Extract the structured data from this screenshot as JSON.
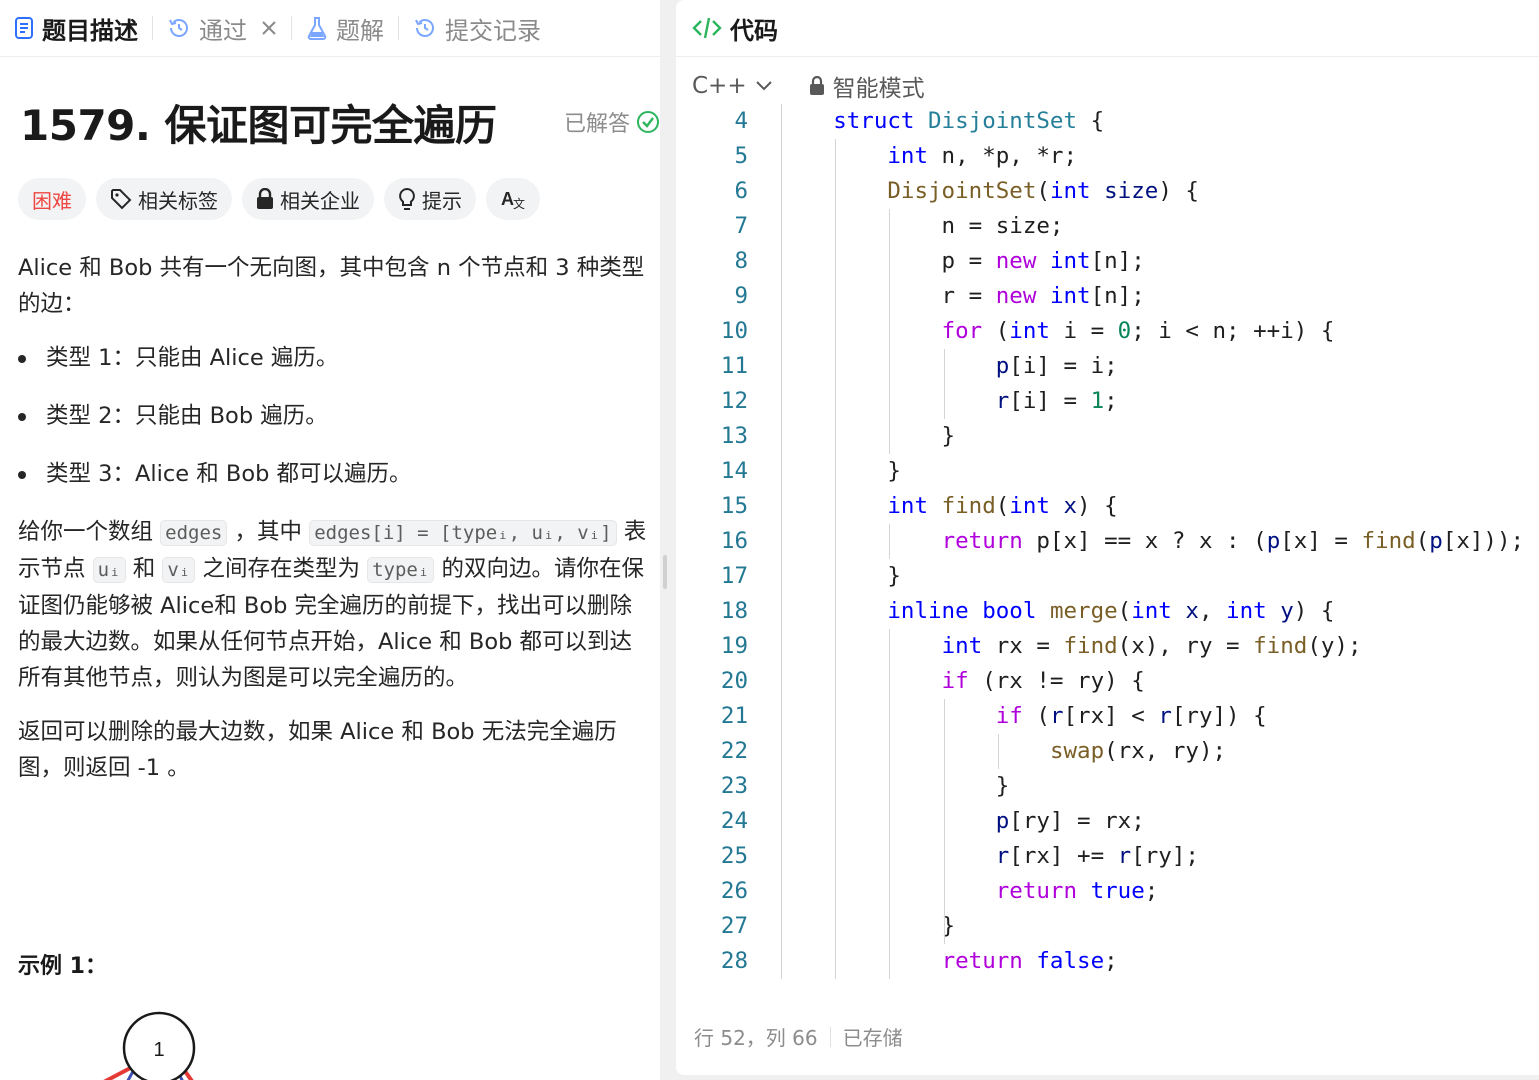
{
  "left_tabs": {
    "description": "题目描述",
    "passed": "通过",
    "solutions": "题解",
    "submissions": "提交记录"
  },
  "problem": {
    "title": "1579. 保证图可完全遍历",
    "status": "已解答",
    "chips": {
      "difficulty": "困难",
      "tags": "相关标签",
      "companies": "相关企业",
      "hint": "提示"
    },
    "intro": "Alice 和 Bob 共有一个无向图，其中包含 n 个节点和 3  种类型的边：",
    "types": [
      "类型 1：只能由 Alice 遍历。",
      "类型 2：只能由 Bob 遍历。",
      "类型 3：Alice 和 Bob 都可以遍历。"
    ],
    "para2": {
      "t1": "给你一个数组",
      "c1": "edges",
      "t2": "，其中",
      "c2": "edges[i] = [typeᵢ, uᵢ, vᵢ]",
      "t3": "表示节点",
      "c3": "uᵢ",
      "t4": "和",
      "c4": "vᵢ",
      "t5": "之间存在类型为",
      "c5": "typeᵢ",
      "t6": "的双向边。请你在保证图仍能够被 Alice和 Bob 完全遍历的前提下，找出可以删除的最大边数。如果从任何节点开始，Alice 和 Bob 都可以到达所有其他节点，则认为图是可以完全遍历的。"
    },
    "para3": "返回可以删除的最大边数，如果 Alice 和 Bob 无法完全遍历图，则返回 -1 。",
    "example_title": "示例 1：",
    "graph_node": "1"
  },
  "editor": {
    "header": "代码",
    "language": "C++",
    "mode": "智能模式",
    "status_position": "行 52，列 66",
    "status_saved": "已存储",
    "line_numbers": [
      "4",
      "5",
      "6",
      "7",
      "8",
      "9",
      "10",
      "11",
      "12",
      "13",
      "14",
      "15",
      "16",
      "17",
      "18",
      "19",
      "20",
      "21",
      "22",
      "23",
      "24",
      "25",
      "26",
      "27",
      "28"
    ]
  },
  "colors": {
    "accent_green": "#2db55d",
    "hard_red": "#ef4743",
    "keyword_blue": "#0000ff",
    "keyword_purple": "#af00db",
    "function_brown": "#795e26",
    "line_number": "#237893"
  }
}
